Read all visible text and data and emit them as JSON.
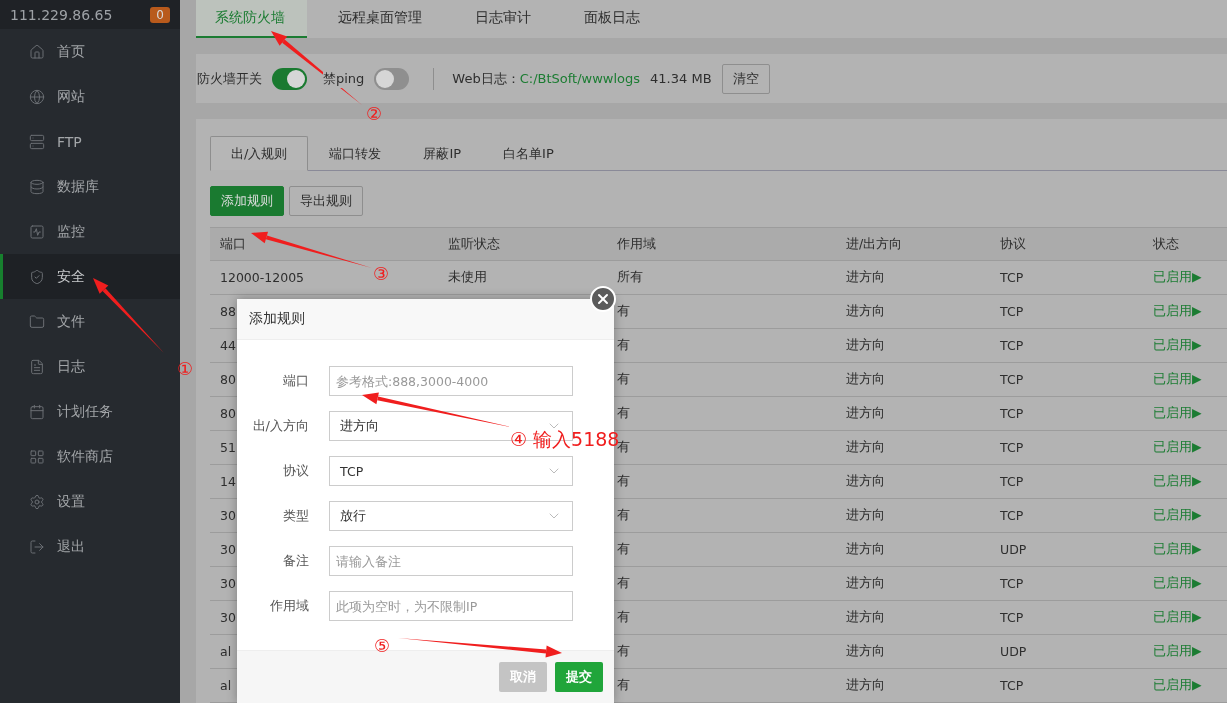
{
  "sidebar": {
    "host": "111.229.86.65",
    "badge": "0",
    "items": [
      {
        "label": "首页",
        "selected": false
      },
      {
        "label": "网站",
        "selected": false
      },
      {
        "label": "FTP",
        "selected": false
      },
      {
        "label": "数据库",
        "selected": false
      },
      {
        "label": "监控",
        "selected": false
      },
      {
        "label": "安全",
        "selected": true
      },
      {
        "label": "文件",
        "selected": false
      },
      {
        "label": "日志",
        "selected": false
      },
      {
        "label": "计划任务",
        "selected": false
      },
      {
        "label": "软件商店",
        "selected": false
      },
      {
        "label": "设置",
        "selected": false
      },
      {
        "label": "退出",
        "selected": false
      }
    ]
  },
  "top_tabs": [
    {
      "label": "系统防火墙",
      "selected": true
    },
    {
      "label": "远程桌面管理",
      "selected": false
    },
    {
      "label": "日志审计",
      "selected": false
    },
    {
      "label": "面板日志",
      "selected": false
    }
  ],
  "firewall_bar": {
    "firewall_label": "防火墙开关",
    "firewall_on": true,
    "ping_label": "禁ping",
    "ping_on": false,
    "web_log_label": "Web日志：",
    "web_log_path": "C:/BtSoft/wwwlogs",
    "web_log_size": "41.34 MB",
    "clear_button": "清空"
  },
  "rule_tabs": [
    {
      "label": "出/入规则",
      "selected": true
    },
    {
      "label": "端口转发",
      "selected": false
    },
    {
      "label": "屏蔽IP",
      "selected": false
    },
    {
      "label": "白名单IP",
      "selected": false
    }
  ],
  "toolbar": [
    {
      "label": "添加规则",
      "kind": "primary"
    },
    {
      "label": "导出规则",
      "kind": "default"
    }
  ],
  "table": {
    "columns": [
      "端口",
      "监听状态",
      "作用域",
      "进/出方向",
      "协议",
      "状态"
    ],
    "rows": [
      {
        "port": "12000-12005",
        "listen": "未使用",
        "scope": "所有",
        "direction": "进方向",
        "protocol": "TCP",
        "status": "已启用▶"
      },
      {
        "port": "88",
        "scope": "有",
        "direction": "进方向",
        "protocol": "TCP",
        "status": "已启用▶"
      },
      {
        "port": "44",
        "scope": "有",
        "direction": "进方向",
        "protocol": "TCP",
        "status": "已启用▶"
      },
      {
        "port": "80",
        "scope": "有",
        "direction": "进方向",
        "protocol": "TCP",
        "status": "已启用▶"
      },
      {
        "port": "80",
        "scope": "有",
        "direction": "进方向",
        "protocol": "TCP",
        "status": "已启用▶"
      },
      {
        "port": "51",
        "scope": "有",
        "direction": "进方向",
        "protocol": "TCP",
        "status": "已启用▶"
      },
      {
        "port": "14",
        "scope": "有",
        "direction": "进方向",
        "protocol": "TCP",
        "status": "已启用▶"
      },
      {
        "port": "30",
        "scope": "有",
        "direction": "进方向",
        "protocol": "TCP",
        "status": "已启用▶"
      },
      {
        "port": "30",
        "scope": "有",
        "direction": "进方向",
        "protocol": "UDP",
        "status": "已启用▶"
      },
      {
        "port": "30",
        "scope": "有",
        "direction": "进方向",
        "protocol": "TCP",
        "status": "已启用▶"
      },
      {
        "port": "30",
        "scope": "有",
        "direction": "进方向",
        "protocol": "TCP",
        "status": "已启用▶"
      },
      {
        "port": "al",
        "scope": "有",
        "direction": "进方向",
        "protocol": "UDP",
        "status": "已启用▶"
      },
      {
        "port": "al",
        "scope": "有",
        "direction": "进方向",
        "protocol": "TCP",
        "status": "已启用▶"
      }
    ]
  },
  "dialog": {
    "title": "添加规则",
    "fields": [
      {
        "label": "端口",
        "kind": "input",
        "placeholder": "参考格式:888,3000-4000"
      },
      {
        "label": "出/入方向",
        "kind": "select",
        "value": "进方向"
      },
      {
        "label": "协议",
        "kind": "select",
        "value": "TCP"
      },
      {
        "label": "类型",
        "kind": "select",
        "value": "放行"
      },
      {
        "label": "备注",
        "kind": "input",
        "placeholder": "请输入备注"
      },
      {
        "label": "作用域",
        "kind": "input",
        "placeholder": "此项为空时，为不限制IP"
      }
    ],
    "buttons": [
      {
        "label": "取消",
        "kind": "cancel"
      },
      {
        "label": "提交",
        "kind": "submit"
      }
    ]
  },
  "annotations": [
    "①",
    "②",
    "③",
    "④ 输入5188",
    "⑤"
  ]
}
